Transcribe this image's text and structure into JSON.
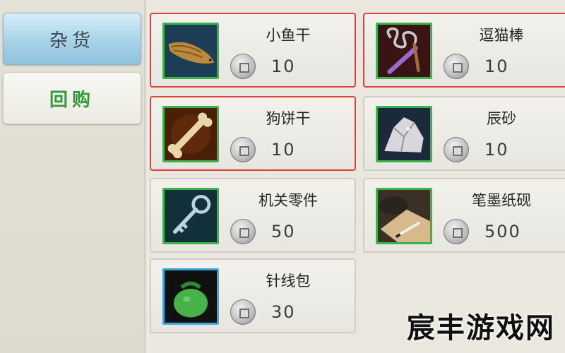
{
  "sidebar": {
    "tabs": [
      {
        "label": "杂货",
        "active": true
      },
      {
        "label": "回购",
        "active": false
      }
    ]
  },
  "shop": {
    "currency_icon": "copper-coin-icon",
    "items": [
      {
        "name": "小鱼干",
        "price": "10",
        "icon": "dried-fish-icon",
        "selected": true
      },
      {
        "name": "逗猫棒",
        "price": "10",
        "icon": "cat-teaser-icon",
        "selected": true
      },
      {
        "name": "狗饼干",
        "price": "10",
        "icon": "dog-biscuit-icon",
        "selected": true
      },
      {
        "name": "辰砂",
        "price": "10",
        "icon": "cinnabar-icon",
        "selected": false
      },
      {
        "name": "机关零件",
        "price": "50",
        "icon": "mechanism-key-icon",
        "selected": false
      },
      {
        "name": "笔墨纸砚",
        "price": "500",
        "icon": "stationery-icon",
        "selected": false
      },
      {
        "name": "针线包",
        "price": "30",
        "icon": "sewing-kit-icon",
        "selected": false
      }
    ]
  },
  "watermark": "宸丰游戏网",
  "colors": {
    "selected_border": "#e0433b",
    "icon_frame_green": "#3bb24a",
    "icon_frame_blue": "#3aa7d8",
    "active_tab": "#a8d2e8",
    "repurchase_text": "#2f9a3a"
  }
}
